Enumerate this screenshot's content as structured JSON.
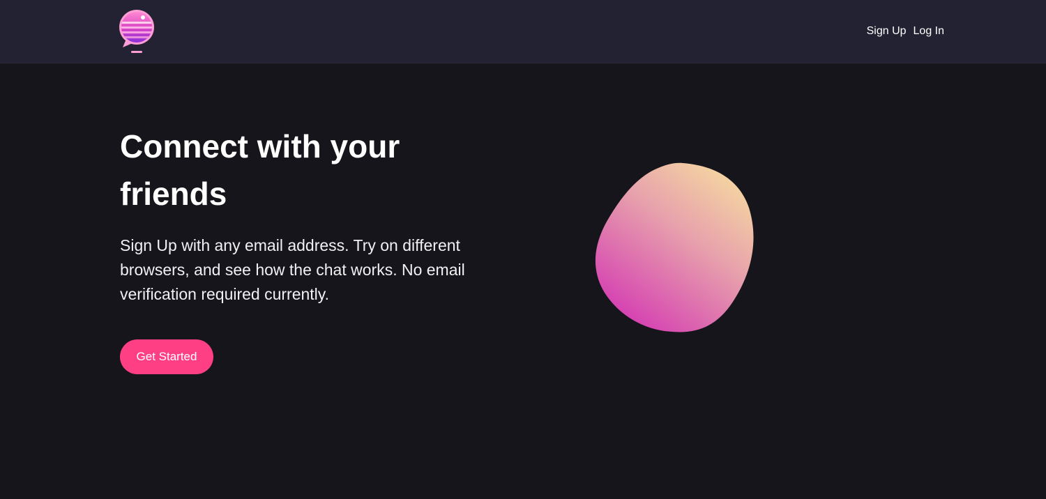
{
  "header": {
    "logo_icon": "chat-bubble-logo-icon",
    "nav": [
      {
        "label": "Sign Up"
      },
      {
        "label": "Log In"
      }
    ]
  },
  "hero": {
    "title": "Connect with your friends",
    "description": "Sign Up with any email address. Try on different browsers, and see how the chat works. No email verification required currently.",
    "cta_label": "Get Started",
    "illustration": "gradient-blob"
  },
  "colors": {
    "page_bg": "#15151b",
    "header_bg": "#222232",
    "accent": "#ff3f84",
    "blob_top": "#f5d7a1",
    "blob_bottom": "#d53fb2"
  }
}
